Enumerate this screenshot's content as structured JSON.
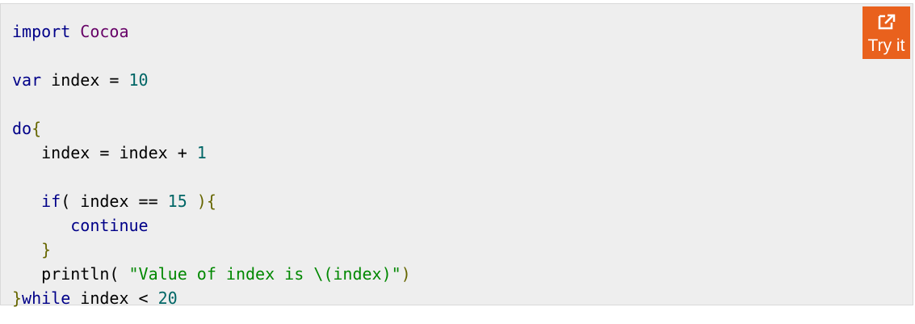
{
  "code": {
    "lines": [
      {
        "tokens": [
          "import",
          " ",
          "Cocoa"
        ]
      },
      {
        "tokens": [
          "var",
          " index = ",
          "10"
        ]
      },
      {
        "tokens": [
          "do",
          "{"
        ]
      },
      {
        "tokens": [
          "   index = index + ",
          "1"
        ]
      },
      {
        "tokens": [
          "   ",
          "if",
          "( index == ",
          "15",
          " ){"
        ]
      },
      {
        "tokens": [
          "      ",
          "continue"
        ]
      },
      {
        "tokens": [
          "   }"
        ]
      },
      {
        "tokens": [
          "   println( ",
          "\"Value of index is \\(index)\"",
          ")"
        ]
      },
      {
        "tokens": [
          "}",
          "while",
          " index < ",
          "20"
        ]
      }
    ]
  },
  "try_it": {
    "label": "Try it",
    "icon": "external-link-icon",
    "color": "#e9611d"
  },
  "colors": {
    "background": "#eeeeee",
    "keyword": "#000088",
    "string": "#008800",
    "number": "#006666",
    "type": "#660066"
  }
}
